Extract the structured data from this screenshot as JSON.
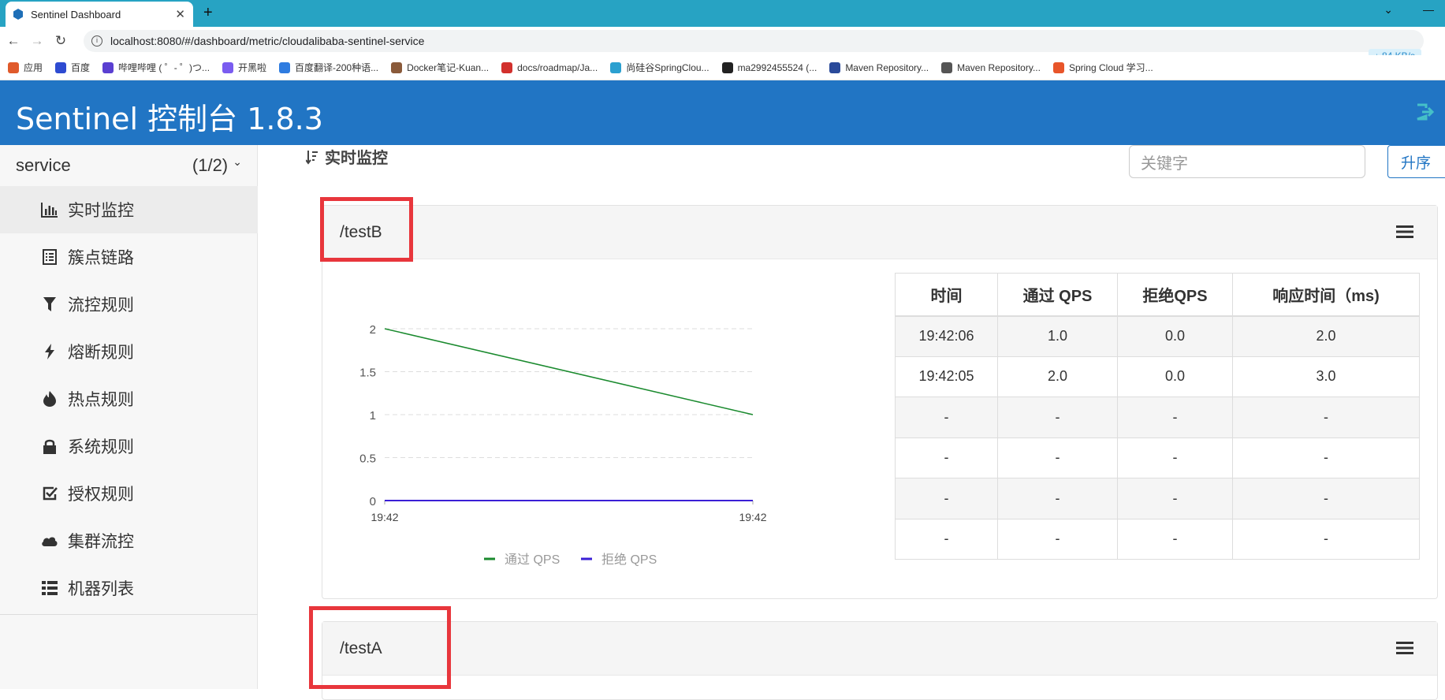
{
  "browser": {
    "tab_title": "Sentinel Dashboard",
    "new_tab": "+",
    "url": "localhost:8080/#/dashboard/metric/cloudalibaba-sentinel-service",
    "net_speed": "↓ 84 KB/s",
    "bookmarks": [
      {
        "label": "应用",
        "color": "#e05a2b"
      },
      {
        "label": "百度",
        "color": "#2e4bd1"
      },
      {
        "label": "哔哩哔哩 ( ゜- ゜)つ...",
        "color": "#5a3fd1"
      },
      {
        "label": "开黑啦",
        "color": "#7a5cf0"
      },
      {
        "label": "百度翻译-200种语...",
        "color": "#2f7ce0"
      },
      {
        "label": "Docker笔记-Kuan...",
        "color": "#8a5a3a"
      },
      {
        "label": "docs/roadmap/Ja...",
        "color": "#d2302d"
      },
      {
        "label": "尚硅谷SpringClou...",
        "color": "#2ba0d0"
      },
      {
        "label": "ma2992455524 (...",
        "color": "#222222"
      },
      {
        "label": "Maven Repository...",
        "color": "#2a4a9a"
      },
      {
        "label": "Maven Repository...",
        "color": "#555555"
      },
      {
        "label": "Spring Cloud 学习...",
        "color": "#e8552a"
      }
    ]
  },
  "header": {
    "title": "Sentinel 控制台 1.8.3"
  },
  "sidebar": {
    "app_name": "service",
    "app_count": "(1/2)",
    "items": [
      {
        "label": "实时监控",
        "icon": "bar-chart-icon"
      },
      {
        "label": "簇点链路",
        "icon": "list-alt-icon"
      },
      {
        "label": "流控规则",
        "icon": "filter-icon"
      },
      {
        "label": "熔断规则",
        "icon": "flash-icon"
      },
      {
        "label": "热点规则",
        "icon": "fire-icon"
      },
      {
        "label": "系统规则",
        "icon": "lock-icon"
      },
      {
        "label": "授权规则",
        "icon": "check-icon"
      },
      {
        "label": "集群流控",
        "icon": "cloud-icon"
      },
      {
        "label": "机器列表",
        "icon": "th-list-icon"
      }
    ]
  },
  "main": {
    "section_title": "实时监控",
    "search_placeholder": "关键字",
    "sort_button": "升序",
    "cards": [
      {
        "resource": "/testB",
        "table": {
          "headers": [
            "时间",
            "通过 QPS",
            "拒绝QPS",
            "响应时间（ms)"
          ],
          "rows": [
            [
              "19:42:06",
              "1.0",
              "0.0",
              "2.0"
            ],
            [
              "19:42:05",
              "2.0",
              "0.0",
              "3.0"
            ],
            [
              "-",
              "-",
              "-",
              "-"
            ],
            [
              "-",
              "-",
              "-",
              "-"
            ],
            [
              "-",
              "-",
              "-",
              "-"
            ],
            [
              "-",
              "-",
              "-",
              "-"
            ]
          ]
        }
      },
      {
        "resource": "/testA"
      }
    ]
  },
  "chart_data": {
    "type": "line",
    "x": [
      "19:42",
      "19:42"
    ],
    "series": [
      {
        "name": "通过 QPS",
        "values": [
          2,
          1
        ],
        "color": "#1a8a2e"
      },
      {
        "name": "拒绝 QPS",
        "values": [
          0,
          0
        ],
        "color": "#3a1fd6"
      }
    ],
    "yticks": [
      "0",
      "0.5",
      "1",
      "1.5",
      "2"
    ],
    "ylim": [
      0,
      2
    ],
    "grid": true,
    "legend": "bottom"
  }
}
